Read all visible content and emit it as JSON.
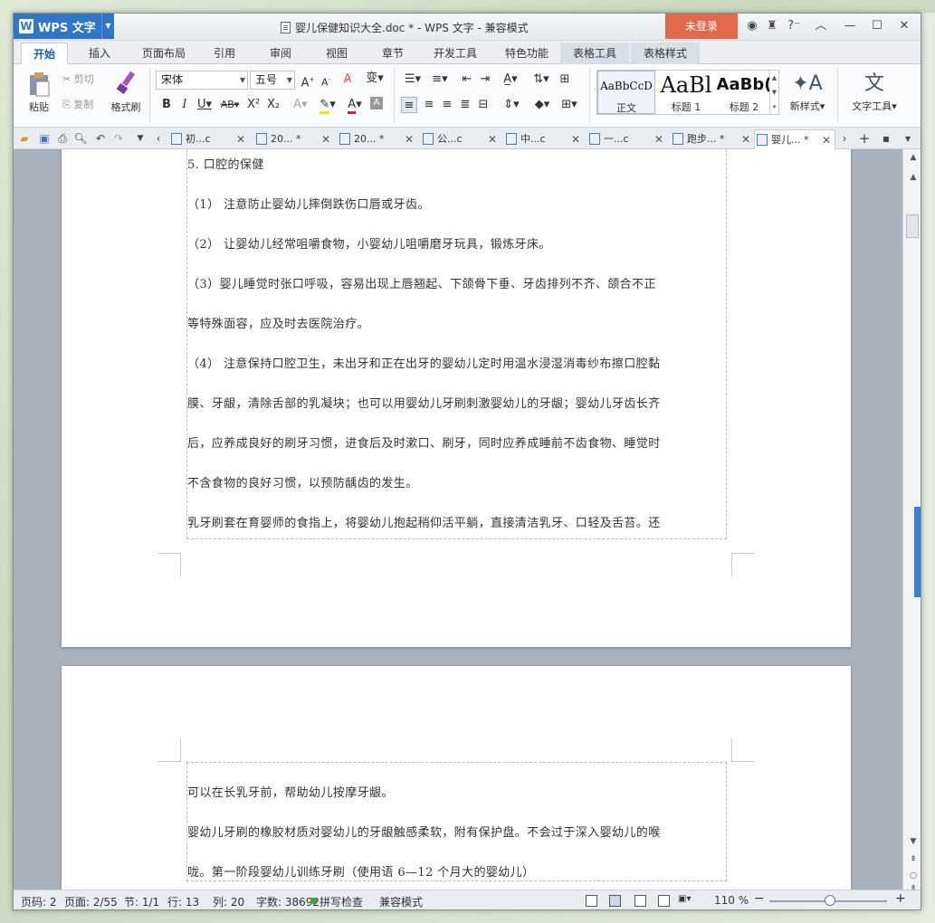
{
  "app": {
    "name": "WPS 文字",
    "login": "未登录"
  },
  "title": {
    "text": "婴儿保健知识大全.doc * - WPS 文字 - 兼容模式"
  },
  "menu_tabs": [
    "开始",
    "插入",
    "页面布局",
    "引用",
    "审阅",
    "视图",
    "章节",
    "开发工具",
    "特色功能",
    "表格工具",
    "表格样式"
  ],
  "ribbon": {
    "paste": "粘贴",
    "cut": "剪切",
    "copy": "复制",
    "format_painter": "格式刷",
    "font_name": "宋体",
    "font_size": "五号",
    "styles": [
      {
        "preview": "AaBbCcD",
        "label": "正文"
      },
      {
        "preview": "AaBl",
        "label": "标题 1"
      },
      {
        "preview": "AaBb(",
        "label": "标题 2"
      }
    ],
    "new_style": "新样式",
    "text_tools": "文字工具"
  },
  "doc_tabs": [
    "初...c",
    "20... *",
    "20... *",
    "公...c",
    "中...c",
    "一...c",
    "跑步... *",
    "婴儿... *"
  ],
  "document": {
    "page1_lines": [
      "5. 口腔的保健",
      "（1） 注意防止婴幼儿摔倒跌伤口唇或牙齿。",
      "（2） 让婴幼儿经常咀嚼食物，小婴幼儿咀嚼磨牙玩具，锻炼牙床。",
      "（3）婴儿睡觉时张口呼吸，容易出现上唇翘起、下颌骨下垂、牙齿排列不齐、颌合不正",
      "等特殊面容，应及时去医院治疗。",
      "（4） 注意保持口腔卫生，未出牙和正在出牙的婴幼儿定时用温水浸湿消毒纱布擦口腔黏",
      "膜、牙龈，清除舌部的乳凝块；也可以用婴幼儿牙刷刺激婴幼儿的牙龈；婴幼儿牙齿长齐",
      "后，应养成良好的刷牙习惯，进食后及时漱口、刷牙，同时应养成睡前不齿食物、睡觉时",
      "不含食物的良好习惯，以预防龋齿的发生。",
      "乳牙刷套在育婴师的食指上，将婴幼儿抱起稍仰活平躺，直接清洁乳牙、口轻及舌苔。还"
    ],
    "page2_lines": [
      "可以在长乳牙前，帮助幼儿按摩牙龈。",
      "婴幼儿牙刷的橡胶材质对婴幼儿的牙龈触感柔软，附有保护盘。不会过于深入婴幼儿的喉",
      "咙。第一阶段婴幼儿训练牙刷（使用语 6—12 个月大的婴幼儿）"
    ]
  },
  "status": {
    "page_code": "页码: 2",
    "page": "页面: 2/55",
    "section": "节: 1/1",
    "row": "行: 13",
    "col": "列: 20",
    "word_count": "字数: 38692",
    "spell_check": "拼写检查",
    "compat": "兼容模式",
    "zoom": "110 %"
  },
  "colors": {
    "accent": "#2f76c6",
    "login": "#e2694c"
  }
}
